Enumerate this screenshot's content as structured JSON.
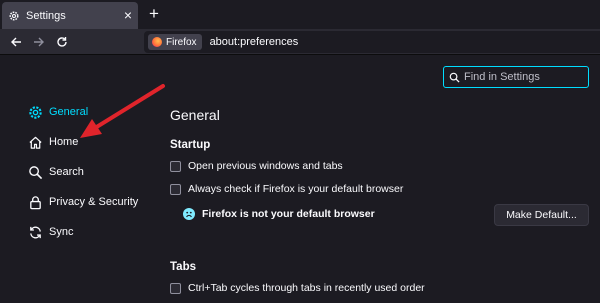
{
  "tab": {
    "title": "Settings",
    "icon": "gear-icon",
    "close_icon": "close-icon"
  },
  "new_tab": {
    "label": "+",
    "icon": "plus-icon"
  },
  "nav": {
    "back_icon": "back-arrow-icon",
    "forward_icon": "forward-arrow-icon",
    "reload_icon": "reload-icon",
    "identity_label": "Firefox",
    "url": "about:preferences"
  },
  "search": {
    "placeholder": "Find in Settings",
    "icon": "search-icon"
  },
  "sidebar": {
    "items": [
      {
        "label": "General",
        "icon": "gear-icon",
        "selected": true
      },
      {
        "label": "Home",
        "icon": "home-icon",
        "selected": false
      },
      {
        "label": "Search",
        "icon": "search-icon",
        "selected": false
      },
      {
        "label": "Privacy & Security",
        "icon": "lock-icon",
        "selected": false
      },
      {
        "label": "Sync",
        "icon": "sync-icon",
        "selected": false
      }
    ]
  },
  "main": {
    "title": "General",
    "startup": {
      "heading": "Startup",
      "open_previous": {
        "label": "Open previous windows and tabs",
        "checked": false
      },
      "check_default": {
        "label": "Always check if Firefox is your default browser",
        "checked": false
      },
      "status": "Firefox is not your default browser",
      "make_default_button": "Make Default..."
    },
    "tabs": {
      "heading": "Tabs",
      "ctrl_tab": {
        "label": "Ctrl+Tab cycles through tabs in recently used order",
        "checked": false
      }
    }
  },
  "colors": {
    "accent": "#00ddff",
    "annotation_arrow": "#e0242b"
  }
}
